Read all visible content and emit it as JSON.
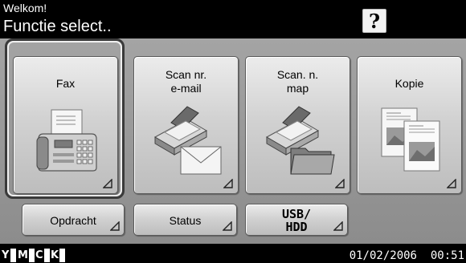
{
  "header": {
    "welcome": "Welkom!",
    "title": "Functie select..",
    "help_label": "?"
  },
  "tiles": [
    {
      "label": "Fax",
      "icon": "fax-icon"
    },
    {
      "label": "Scan nr. e-mail",
      "line1": "Scan nr.",
      "line2": "e-mail",
      "icon": "scan-to-email-icon"
    },
    {
      "label": "Scan. n. map",
      "line1": "Scan. n.",
      "line2": "map",
      "icon": "scan-to-folder-icon"
    },
    {
      "label": "Kopie",
      "icon": "copy-icon"
    }
  ],
  "buttons": {
    "job": "Opdracht",
    "status": "Status",
    "usb_line1": "USB/",
    "usb_line2": "HDD"
  },
  "footer": {
    "toner": [
      "Y",
      "M",
      "C",
      "K"
    ],
    "datetime": "01/02/2006  00:51"
  },
  "colors": {
    "panel": "#9a9a9a",
    "tile": "#d8d8d8",
    "selection": "#3a3a3a"
  }
}
